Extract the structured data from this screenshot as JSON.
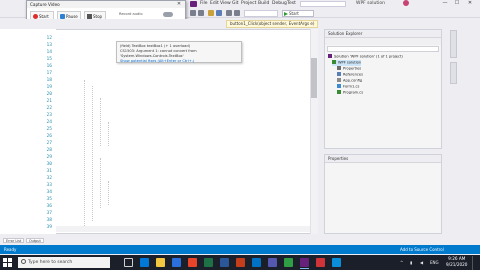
{
  "recorder": {
    "title": "Capture Video",
    "close_glyph": "✕",
    "start_label": "Start",
    "pause_label": "Pause",
    "stop_label": "Stop",
    "option_1": "Record audio",
    "option_2": "Record cursor",
    "status_prefix": "Recording limit 1 min.",
    "status_link": "Upgrade recording time"
  },
  "titlebar": {
    "menu": [
      "File",
      "Edit",
      "View",
      "Git",
      "Project",
      "Build",
      "Debug",
      "Test",
      "Analyze",
      "Tools"
    ],
    "search_placeholder": "Search (Ctrl+Q)",
    "title": "WPF solution",
    "user_initials": "SS",
    "minimize": "—",
    "maximize": "☐",
    "close": "✕"
  },
  "toolbar": {
    "start_label": "Start"
  },
  "editor": {
    "tab_label": "button1_Click(object sender, EventArgs e)",
    "tooltip_line1": "(field) TextBox textBox1 (+ 1 overload)",
    "tooltip_line2": "CS1503: Argument 1: cannot convert from 'System.Windows.Controls.TextBox'",
    "tooltip_line3": "Show potential fixes (Alt+Enter or Ctrl+.)",
    "line_numbers": [
      "12",
      "13",
      "14",
      "15",
      "16",
      "17",
      "18",
      "19",
      "20",
      "21",
      "22",
      "23",
      "24",
      "25",
      "26",
      "27",
      "28",
      "29",
      "30",
      "31",
      "32",
      "33",
      "34",
      "35",
      "36",
      "37",
      "38",
      "39"
    ]
  },
  "solution_explorer": {
    "title": "Solution Explorer",
    "items": [
      "Solution 'WPF solution' (1 of 1 project)",
      "WPF solution",
      "Properties",
      "References",
      "App.config",
      "Form1.cs",
      "Program.cs"
    ]
  },
  "properties": {
    "title": "Properties"
  },
  "bottom": {
    "tab_1": "Error List",
    "tab_2": "Output",
    "status_ready": "Ready",
    "status_right": "Add to Source Control"
  },
  "taskbar": {
    "search_placeholder": "Type here to search",
    "time": "9:26 AM",
    "date": "9/21/2020",
    "tray_lang": "ENG"
  },
  "colors": {
    "accent": "#007acc",
    "vs_purple": "#68217a",
    "keyword": "#0000ff",
    "type": "#2b91af",
    "string": "#a31515"
  }
}
